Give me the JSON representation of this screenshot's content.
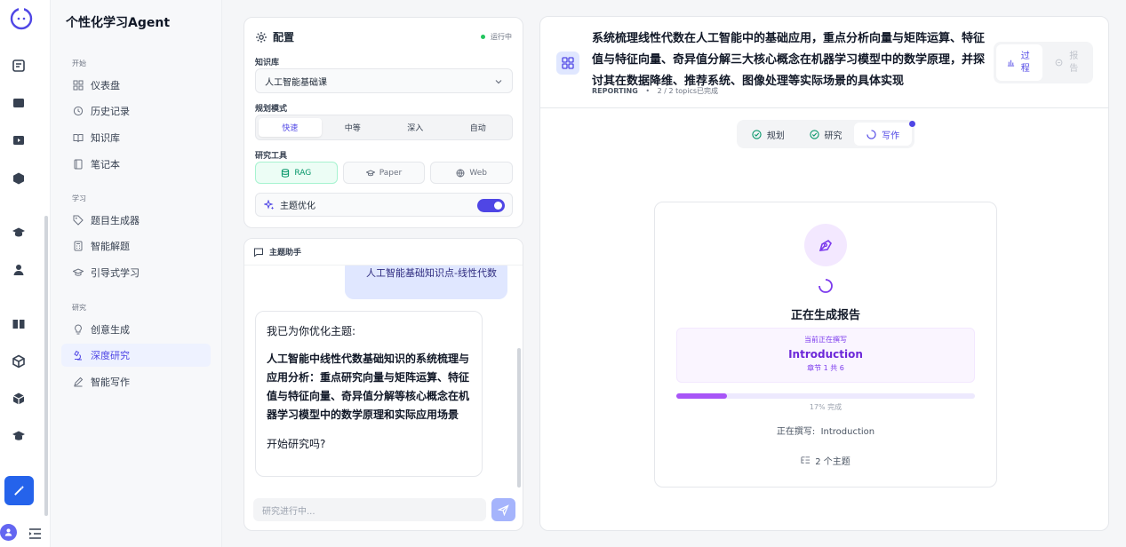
{
  "nav": {
    "brand": "个性化学习Agent",
    "sections": [
      {
        "label": "开始",
        "items": [
          {
            "label": "仪表盘",
            "icon": "dashboard-icon"
          },
          {
            "label": "历史记录",
            "icon": "history-icon"
          },
          {
            "label": "知识库",
            "icon": "book-open-icon"
          },
          {
            "label": "笔记本",
            "icon": "notebook-icon"
          }
        ]
      },
      {
        "label": "学习",
        "items": [
          {
            "label": "题目生成器",
            "icon": "tag-icon"
          },
          {
            "label": "智能解题",
            "icon": "calculator-icon"
          },
          {
            "label": "引导式学习",
            "icon": "graduation-cap-icon"
          }
        ]
      },
      {
        "label": "研究",
        "items": [
          {
            "label": "创意生成",
            "icon": "lightbulb-icon"
          },
          {
            "label": "深度研究",
            "icon": "microscope-icon",
            "active": true
          },
          {
            "label": "智能写作",
            "icon": "pen-icon"
          }
        ]
      }
    ]
  },
  "config": {
    "title": "配置",
    "status": "运行中",
    "kb_label": "知识库",
    "kb_value": "人工智能基础课",
    "mode_label": "规划模式",
    "modes": [
      "快速",
      "中等",
      "深入",
      "自动"
    ],
    "active_mode": "快速",
    "tools_label": "研究工具",
    "tools": [
      {
        "label": "RAG",
        "active": true
      },
      {
        "label": "Paper",
        "active": false
      },
      {
        "label": "Web",
        "active": false
      }
    ],
    "topic_opt": "主题优化",
    "topic_opt_enabled": true
  },
  "assistant": {
    "title": "主题助手",
    "user_msg": "人工智能基础知识点-线性代数",
    "bot_intro": "我已为你优化主题:",
    "bot_topic": "人工智能中线性代数基础知识的系统梳理与应用分析：重点研究向量与矩阵运算、特征值与特征向量、奇异值分解等核心概念在机器学习模型中的数学原理和实际应用场景",
    "bot_q": "开始研究吗?",
    "input_placeholder": "研究进行中..."
  },
  "report": {
    "title": "系统梳理线性代数在人工智能中的基础应用，重点分析向量与矩阵运算、特征值与特征向量、奇异值分解三大核心概念在机器学习模型中的数学原理，并探讨其在数据降维、推荐系统、图像处理等实际场景的具体实现",
    "status": "REPORTING",
    "topics_progress": "2 / 2 topics已完成",
    "view_tabs": [
      {
        "label": "过程",
        "active": true
      },
      {
        "label": "报告",
        "active": false
      }
    ],
    "phases": [
      {
        "label": "规划",
        "state": "done"
      },
      {
        "label": "研究",
        "state": "done"
      },
      {
        "label": "写作",
        "state": "current"
      }
    ],
    "generating": "正在生成报告",
    "current_writing_label": "当前正在撰写",
    "current_section": "Introduction",
    "chapter_info": "章节 1 共 6",
    "progress": 17,
    "progress_text": "17% 完成",
    "writing_now": "正在撰写:  Introduction",
    "topic_count": "2 个主题"
  }
}
